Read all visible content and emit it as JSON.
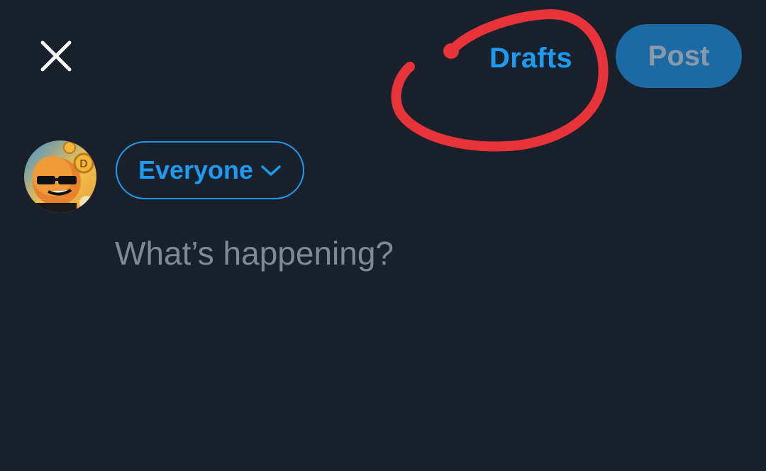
{
  "header": {
    "close_icon": "close-icon",
    "drafts_label": "Drafts",
    "post_label": "Post"
  },
  "composer": {
    "avatar": "avatar",
    "audience_label": "Everyone",
    "audience_icon": "chevron-down-icon",
    "placeholder": "What’s happening?"
  },
  "colors": {
    "background": "#17202b",
    "accent": "#1d9bf0",
    "post_button_bg": "#1c6aa4",
    "post_button_text": "#8a9aaa",
    "placeholder_text": "#7d8a97",
    "annotation_marker": "#e8333a"
  }
}
